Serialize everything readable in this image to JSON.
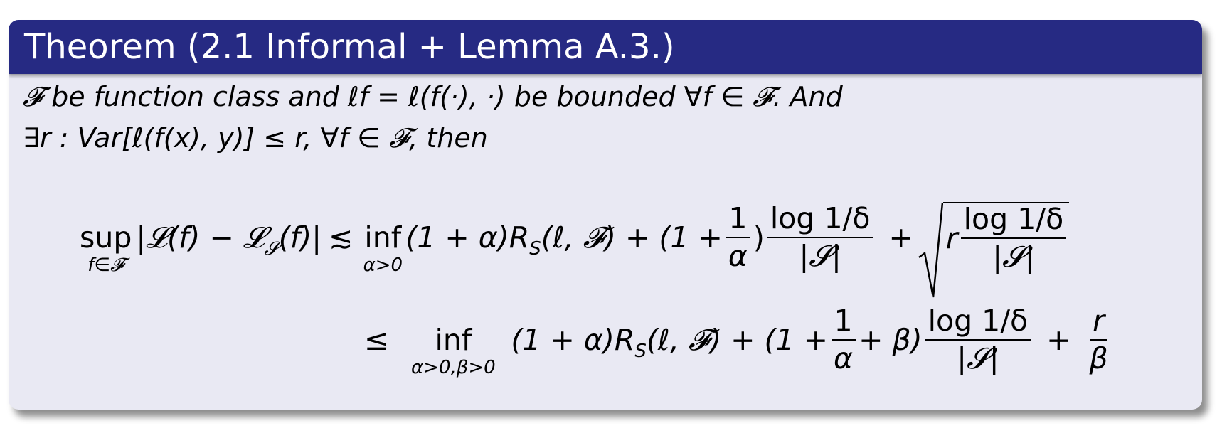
{
  "block": {
    "title": "Theorem (2.1 Informal + Lemma A.3.)"
  },
  "statement": {
    "line1": "𝓕 be function class and ℓf = ℓ(f(·), ·) be bounded ∀f ∈ 𝓕. And",
    "line2": "∃r : Var[ℓ(f(x), y)] ≤ r, ∀f ∈ 𝓕, then"
  },
  "equation": {
    "row1": {
      "sup_op": "sup",
      "sup_sub": "f∈𝓕",
      "lhs": "|𝓛(f) − 𝓛",
      "lhs_sub": "𝓢",
      "lhs_end": "(f)|",
      "relation": "≲",
      "inf_op": "inf",
      "inf_sub": "α>0",
      "term1": "(1 + α)R",
      "term1_sub": "S",
      "term1_end": "(ℓ, 𝓕) + (1 +",
      "frac1_num": "1",
      "frac1_den": "α",
      "close1": ")",
      "frac2_num": "log 1/δ",
      "frac2_den": "|𝓢|",
      "plus": "+",
      "sqrt_r": "r",
      "frac3_num": "log 1/δ",
      "frac3_den": "|𝓢|"
    },
    "row2": {
      "relation": "≤",
      "inf_op": "inf",
      "inf_sub": "α>0,β>0",
      "term1": "(1 + α)R",
      "term1_sub": "S",
      "term1_end": "(ℓ, 𝓕) + (1 +",
      "frac1_num": "1",
      "frac1_den": "α",
      "mid": "+ β)",
      "frac2_num": "log 1/δ",
      "frac2_den": "|𝓢|",
      "plus": "+",
      "frac3_num": "r",
      "frac3_den": "β"
    }
  },
  "colors": {
    "title_bg": "#262a83",
    "body_bg": "#e9e9f3",
    "title_text": "#ffffff"
  }
}
